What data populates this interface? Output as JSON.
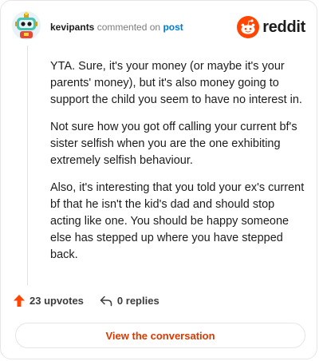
{
  "comment": {
    "username": "kevipants",
    "action_text": "commented on",
    "post_link_label": "post",
    "paragraphs": [
      "YTA. Sure, it's your money (or maybe it's your parents' money), but it's also money going to support the child you seem to have no interest in.",
      "Not sure how you got off calling your current bf's sister selfish when you are the one exhibiting extremely selfish behaviour.",
      "Also, it's interesting that you told your ex's current bf that he isn't the kid's dad and should stop acting like one. You should be happy someone else has stepped up where you have stepped back."
    ]
  },
  "brand": {
    "wordmark": "reddit",
    "accent_color": "#ff4500"
  },
  "footer": {
    "upvotes_label": "23 upvotes",
    "replies_label": "0 replies"
  },
  "cta": {
    "view_conversation_label": "View the conversation"
  },
  "icons": {
    "avatar": "avatar-robot-icon",
    "logo": "reddit-alien-icon",
    "upvote": "upvote-arrow-icon",
    "reply": "reply-arrow-icon"
  }
}
